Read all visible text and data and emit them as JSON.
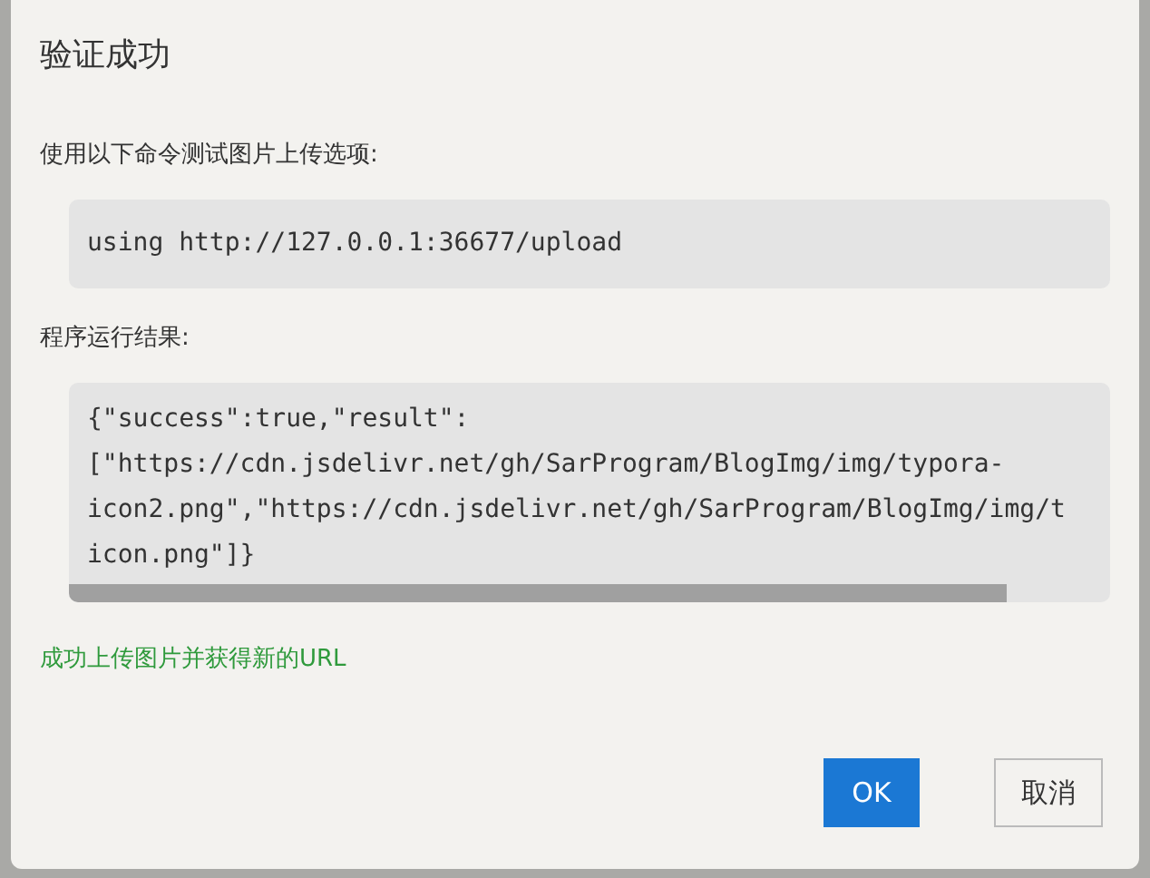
{
  "dialog": {
    "title": "验证成功",
    "command_label": "使用以下命令测试图片上传选项:",
    "command": "using http://127.0.0.1:36677/upload",
    "result_label": "程序运行结果:",
    "result_lines": [
      "{\"success\":true,\"result\":",
      "[\"https://cdn.jsdelivr.net/gh/SarProgram/BlogImg/img/typora-",
      "icon2.png\",\"https://cdn.jsdelivr.net/gh/SarProgram/BlogImg/img/t",
      "icon.png\"]}"
    ],
    "status_message": "成功上传图片并获得新的URL",
    "buttons": [
      {
        "label": "OK",
        "kind": "primary"
      },
      {
        "label": "取消",
        "kind": "secondary"
      }
    ]
  }
}
